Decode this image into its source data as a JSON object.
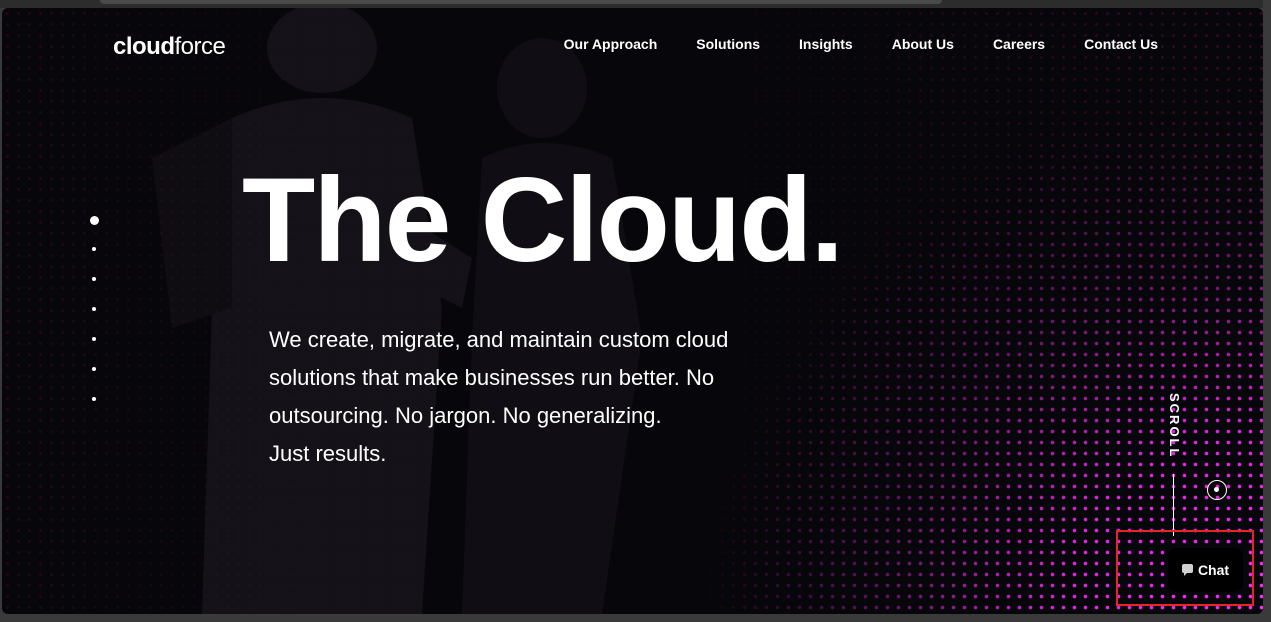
{
  "brand": {
    "logo_bold": "cloud",
    "logo_light": "force"
  },
  "nav": {
    "items": [
      {
        "label": "Our Approach"
      },
      {
        "label": "Solutions"
      },
      {
        "label": "Insights"
      },
      {
        "label": "About Us"
      },
      {
        "label": "Careers"
      },
      {
        "label": "Contact Us"
      }
    ]
  },
  "hero": {
    "headline": "The Cloud.",
    "description_lines": [
      "We create, migrate, and maintain custom cloud",
      "solutions that make businesses run better. No",
      "outsourcing. No jargon. No generalizing.",
      "Just results."
    ],
    "slide_count": 7,
    "active_slide": 1
  },
  "scroll": {
    "label": "SCROLL"
  },
  "chat": {
    "label": "Chat",
    "icon": "chat-bubble-icon"
  },
  "colors": {
    "background": "#07060a",
    "accent": "#ff2bff",
    "text": "#ffffff",
    "highlight": "#e6242c"
  }
}
